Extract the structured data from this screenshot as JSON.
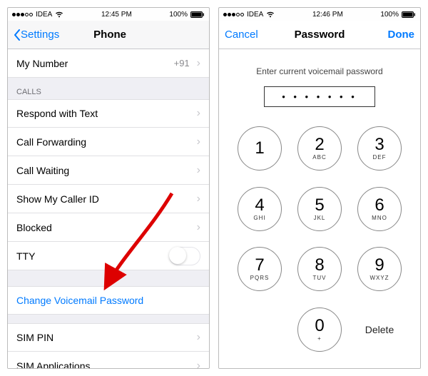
{
  "left": {
    "status": {
      "carrier": "IDEA",
      "time": "12:45 PM",
      "battery": "100%"
    },
    "nav": {
      "back": "Settings",
      "title": "Phone"
    },
    "my_number": {
      "label": "My Number",
      "value": "+91"
    },
    "calls_header": "CALLS",
    "rows": {
      "respond": "Respond with Text",
      "forwarding": "Call Forwarding",
      "waiting": "Call Waiting",
      "callerid": "Show My Caller ID",
      "blocked": "Blocked",
      "tty": "TTY",
      "change_pw": "Change Voicemail Password",
      "sim_pin": "SIM PIN",
      "sim_apps": "SIM Applications"
    }
  },
  "right": {
    "status": {
      "carrier": "IDEA",
      "time": "12:46 PM",
      "battery": "100%"
    },
    "nav": {
      "cancel": "Cancel",
      "title": "Password",
      "done": "Done"
    },
    "prompt": "Enter current voicemail password",
    "mask": "• • • • • • •",
    "keys": [
      {
        "d": "1",
        "l": ""
      },
      {
        "d": "2",
        "l": "ABC"
      },
      {
        "d": "3",
        "l": "DEF"
      },
      {
        "d": "4",
        "l": "GHI"
      },
      {
        "d": "5",
        "l": "JKL"
      },
      {
        "d": "6",
        "l": "MNO"
      },
      {
        "d": "7",
        "l": "PQRS"
      },
      {
        "d": "8",
        "l": "TUV"
      },
      {
        "d": "9",
        "l": "WXYZ"
      },
      {
        "d": "0",
        "l": "+"
      }
    ],
    "delete": "Delete"
  }
}
